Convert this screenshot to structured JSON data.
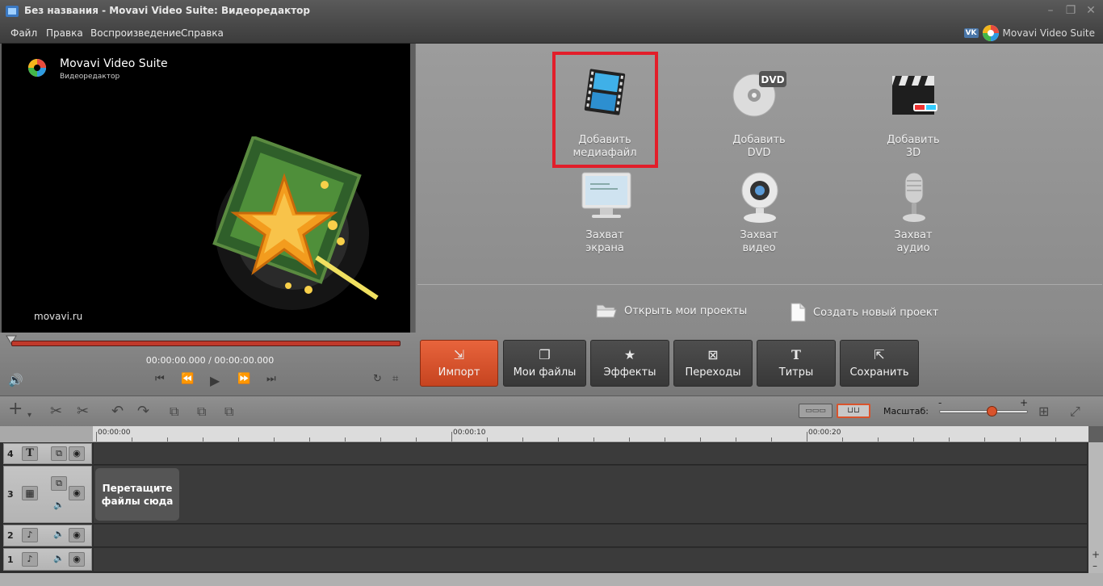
{
  "window": {
    "title": "Без названия - Movavi Video Suite: Видеоредактор",
    "controls": {
      "minimize": "–",
      "restore": "❐",
      "close": "✕"
    }
  },
  "menu": {
    "items": [
      "Файл",
      "Правка",
      "Воспроизведение",
      "Справка"
    ],
    "brand": "Movavi Video Suite",
    "vk_icon": "VK"
  },
  "preview": {
    "brand_title": "Movavi Video Suite",
    "brand_subtitle": "Видеоредактор",
    "site": "movavi.ru"
  },
  "import_panel": {
    "tiles": [
      {
        "label_line1": "Добавить",
        "label_line2": "медиафайл",
        "icon": "film-icon",
        "highlighted": true
      },
      {
        "label_line1": "Добавить",
        "label_line2": "DVD",
        "icon": "dvd-icon",
        "badge": "DVD"
      },
      {
        "label_line1": "Добавить",
        "label_line2": "3D",
        "icon": "clapperboard-icon"
      },
      {
        "label_line1": "Захват",
        "label_line2": "экрана",
        "icon": "monitor-icon"
      },
      {
        "label_line1": "Захват",
        "label_line2": "видео",
        "icon": "webcam-icon"
      },
      {
        "label_line1": "Захват",
        "label_line2": "аудио",
        "icon": "microphone-icon"
      }
    ],
    "open_projects": "Открыть мои проекты",
    "new_project": "Создать новый проект",
    "highlight_color": "#e21e2a"
  },
  "player": {
    "timecode": "00:00:00.000  / 00:00:00.000",
    "progress_fraction": 0
  },
  "tabs": [
    {
      "label": "Импорт",
      "icon": "import-icon",
      "glyph": "⇲",
      "active": true
    },
    {
      "label": "Мои файлы",
      "icon": "files-icon",
      "glyph": "❐",
      "active": false
    },
    {
      "label": "Эффекты",
      "icon": "star-icon",
      "glyph": "★",
      "active": false
    },
    {
      "label": "Переходы",
      "icon": "transition-icon",
      "glyph": "⊠",
      "active": false
    },
    {
      "label": "Титры",
      "icon": "titles-icon",
      "glyph": "T",
      "active": false
    },
    {
      "label": "Сохранить",
      "icon": "save-icon",
      "glyph": "⇱",
      "active": false
    }
  ],
  "timeline": {
    "scale_label": "Масштаб:",
    "scale_minus": "-",
    "scale_plus": "+",
    "ruler_labels": [
      "00:00:00",
      "00:00:10",
      "00:00:20"
    ],
    "tracks": [
      {
        "number": "4",
        "type_icon": "T"
      },
      {
        "number": "3",
        "type_icon": "▦"
      },
      {
        "number": "2",
        "type_icon": "♪"
      },
      {
        "number": "1",
        "type_icon": "♪"
      }
    ],
    "drop_hint_line1": "Перетащите",
    "drop_hint_line2": "файлы сюда"
  },
  "colors": {
    "accent": "#d9532c",
    "highlight": "#e21e2a"
  }
}
